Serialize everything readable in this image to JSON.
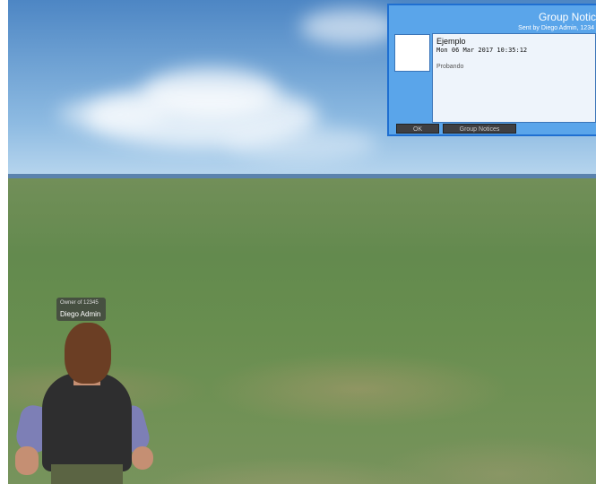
{
  "notice": {
    "title": "Group Notic",
    "sender": "Sent by Diego Admin, 1234",
    "subject": "Ejemplo",
    "date": "Mon 06 Mar 2017 10:35:12",
    "message": "Probando",
    "ok_label": "OK",
    "group_notices_label": "Group Notices"
  },
  "avatar": {
    "owner_line": "Owner of 12345",
    "name": "Diego Admin"
  },
  "colors": {
    "window_bg": "#5aa5ea",
    "window_border": "#1f6fd1",
    "button_bg": "#3f3f41",
    "sky": "#6ea1d3",
    "ground": "#628a48"
  },
  "icons": [
    "group-insignia-icon"
  ]
}
